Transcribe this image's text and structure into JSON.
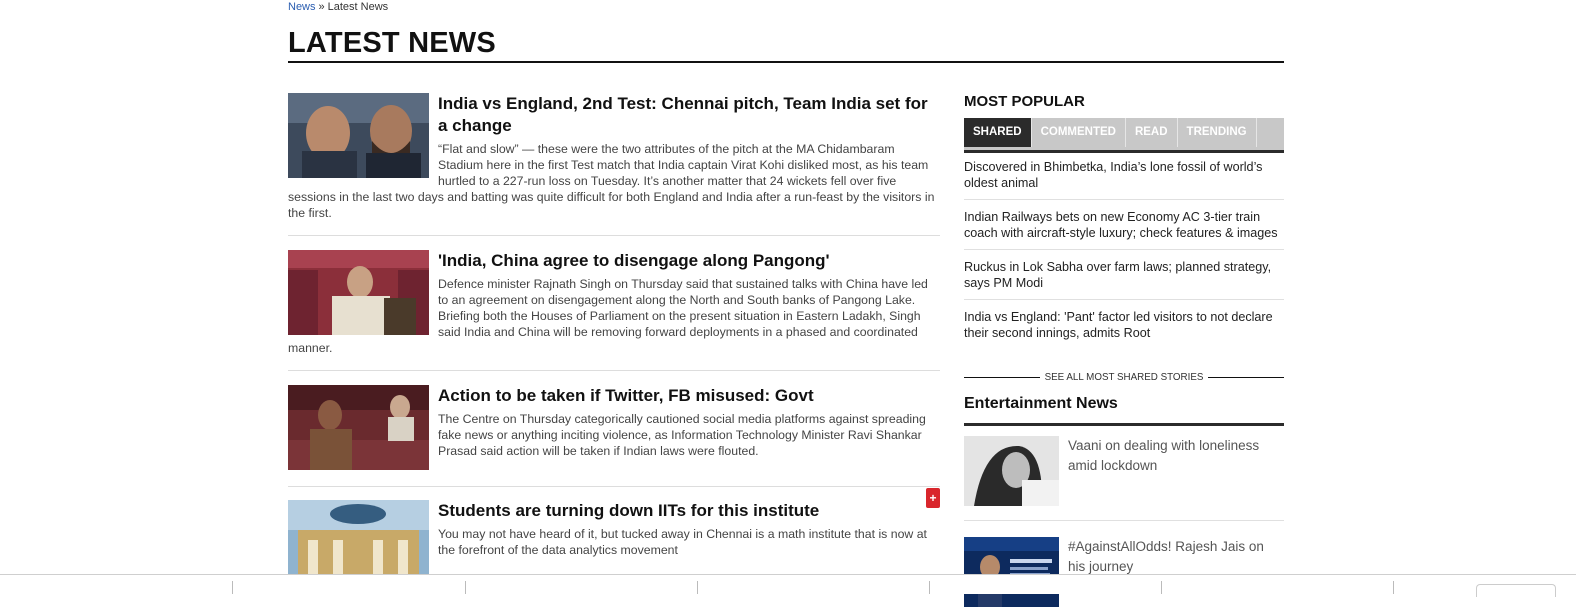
{
  "breadcrumb": {
    "root": "News",
    "separator": "»",
    "current": "Latest News"
  },
  "page": {
    "title": "LATEST NEWS"
  },
  "articles": [
    {
      "headline": "India vs England, 2nd Test: Chennai pitch, Team India set for a change",
      "summary": "“Flat and slow” — these were the two attributes of the pitch at the MA Chidambaram Stadium here in the first Test match that India captain Virat Kohi disliked most, as his team hurtled to a 227-run loss on Tuesday. It’s another matter that 24 wickets fell over five sessions in the last two days and batting was quite difficult for both England and India after a run-feast by the visitors in the first."
    },
    {
      "headline": "'India, China agree to disengage along Pangong'",
      "summary": "Defence minister Rajnath Singh on Thursday said that sustained talks with China have led to an agreement on disengagement along the North and South banks of Pangong Lake. Briefing both the Houses of Parliament on the present situation in Eastern Ladakh, Singh said India and China will be removing forward deployments in a phased and coordinated manner."
    },
    {
      "headline": "Action to be taken if Twitter, FB misused: Govt",
      "summary": "The Centre on Thursday categorically cautioned social media platforms against spreading fake news or anything inciting violence, as Information Technology Minister Ravi Shankar Prasad said action will be taken if Indian laws were flouted."
    },
    {
      "headline": "Students are turning down IITs for this institute",
      "summary": "You may not have heard of it, but tucked away in Chennai is a math institute that is now at the forefront of the data analytics movement"
    }
  ],
  "sidebar": {
    "most_popular_heading": "MOST POPULAR",
    "tabs": [
      "SHARED",
      "COMMENTED",
      "READ",
      "TRENDING"
    ],
    "active_tab": "SHARED",
    "popular_items": [
      "Discovered in Bhimbetka, India’s lone fossil of world’s oldest animal",
      "Indian Railways bets on new Economy AC 3-tier train coach with aircraft-style luxury; check features & images",
      "Ruckus in Lok Sabha over farm laws; planned strategy, says PM Modi",
      "India vs England: 'Pant' factor led visitors to not declare their second innings, admits Root"
    ],
    "see_all_label": "SEE ALL MOST SHARED STORIES",
    "entertainment_heading": "Entertainment News",
    "entertainment_items": [
      "Vaani on dealing with loneliness amid lockdown",
      "#AgainstAllOdds! Rajesh Jais on his journey"
    ]
  },
  "colors": {
    "accent_dark": "#2b2b2b",
    "tab_inactive": "#c8c8c8",
    "link_blue": "#2a5db0",
    "badge_red": "#d9262c"
  },
  "icons": {
    "floating_badge": "plus-icon"
  }
}
